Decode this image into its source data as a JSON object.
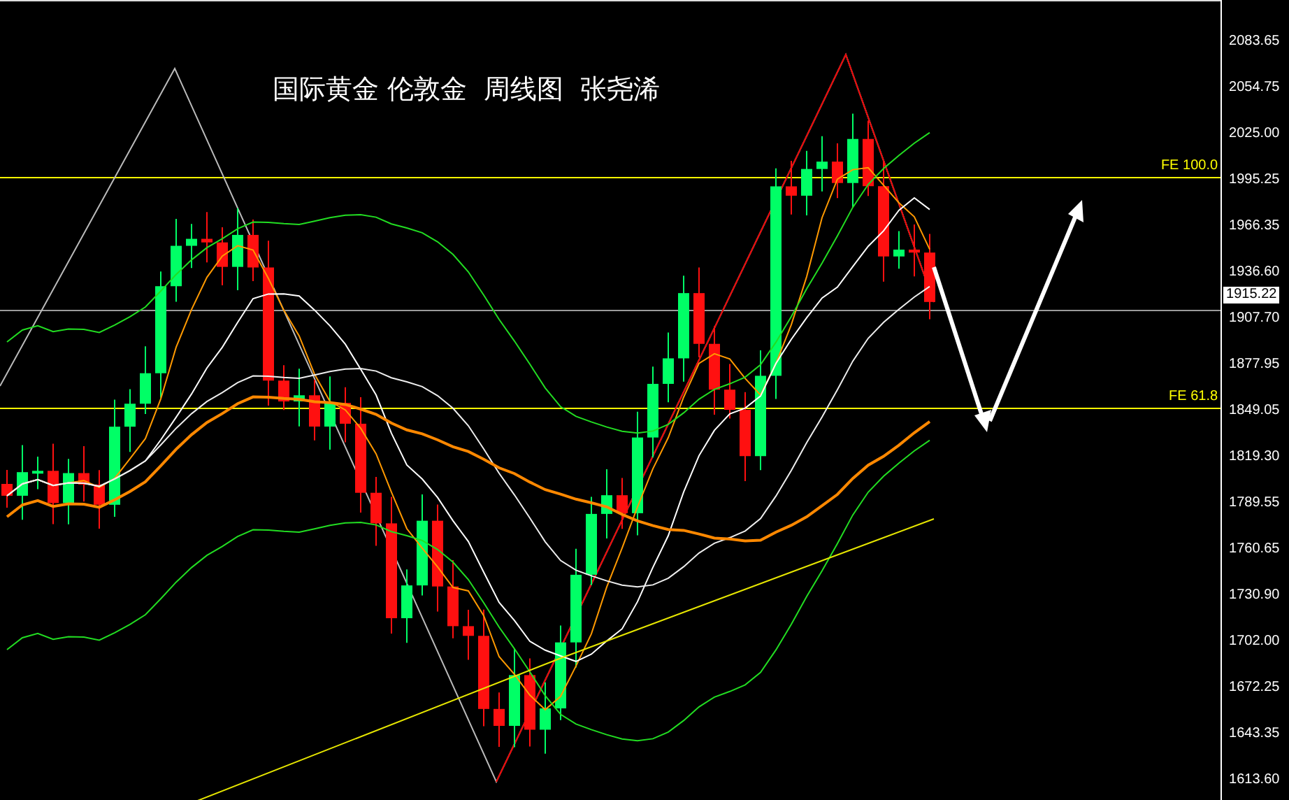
{
  "chart_title": "国际黄金 伦敦金  周线图  张尧浠",
  "fibonacci_levels": [
    {
      "label": "FE 100.0"
    },
    {
      "label": "FE 61.8"
    }
  ],
  "current_price": "1915.22",
  "price_axis": [
    "2083.65",
    "2054.75",
    "2025.00",
    "1995.25",
    "1966.35",
    "1936.60",
    "1907.70",
    "1877.95",
    "1849.05",
    "1819.30",
    "1789.55",
    "1760.65",
    "1730.90",
    "1702.00",
    "1672.25",
    "1643.35",
    "1613.60"
  ]
}
